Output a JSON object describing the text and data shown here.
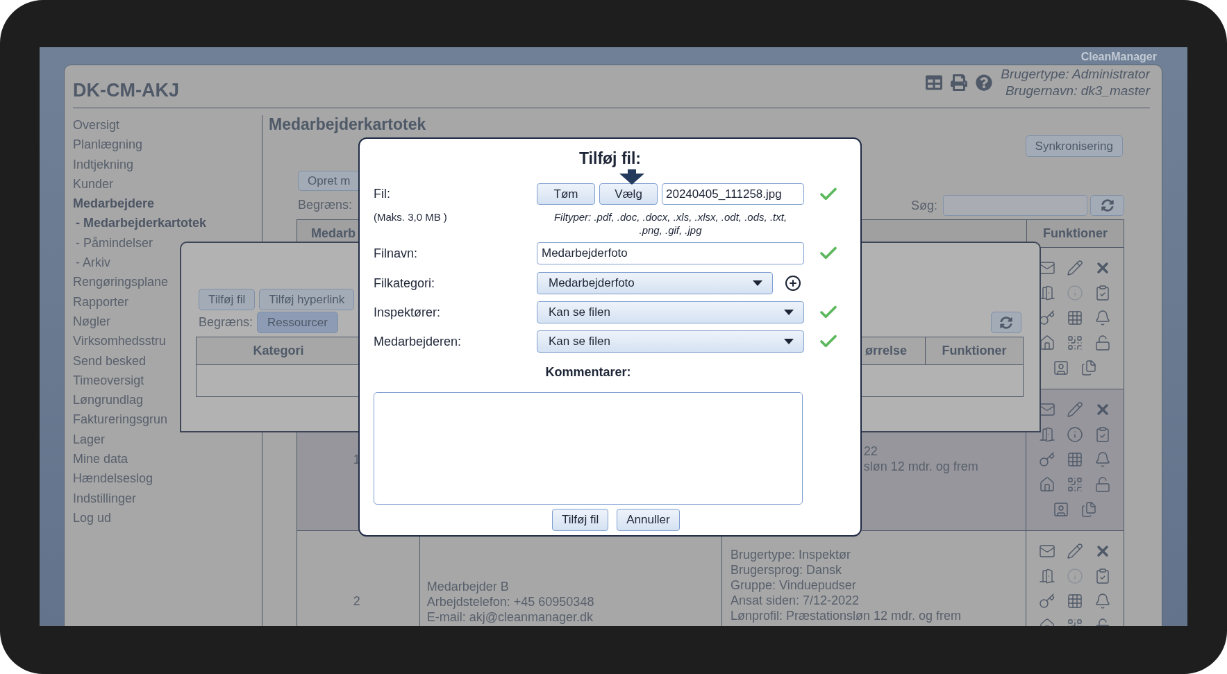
{
  "brand": "CleanManager",
  "app_title": "DK-CM-AKJ",
  "user_info": [
    "Brugertype: Administrator",
    "Brugernavn: dk3_master"
  ],
  "sidebar": {
    "items": [
      {
        "label": "Oversigt",
        "selected": false
      },
      {
        "label": "Planlægning",
        "selected": false
      },
      {
        "label": "Indtjekning",
        "selected": false
      },
      {
        "label": "Kunder",
        "selected": false
      },
      {
        "label": "Medarbejdere",
        "selected": true,
        "children": [
          {
            "label": "- Medarbejderkartotek",
            "selected": true
          },
          {
            "label": "- Påmindelser",
            "selected": false
          },
          {
            "label": "- Arkiv",
            "selected": false
          }
        ]
      },
      {
        "label": "Rengøringsplane",
        "selected": false
      },
      {
        "label": "Rapporter",
        "selected": false
      },
      {
        "label": "Nøgler",
        "selected": false
      },
      {
        "label": "Virksomhedsstru",
        "selected": false
      },
      {
        "label": "Send besked",
        "selected": false
      },
      {
        "label": "Timeoversigt",
        "selected": false
      },
      {
        "label": "Løngrundlag",
        "selected": false
      },
      {
        "label": "Faktureringsgrun",
        "selected": false
      },
      {
        "label": "Lager",
        "selected": false
      },
      {
        "label": "Mine data",
        "selected": false
      },
      {
        "label": "Hændelseslog",
        "selected": false
      },
      {
        "label": "Indstillinger",
        "selected": false
      },
      {
        "label": "Log ud",
        "selected": false
      }
    ]
  },
  "page": {
    "heading": "Medarbejderkartotek",
    "sync_button": "Synkronisering",
    "create_button": "Opret m",
    "filter_label": "Begræns:",
    "search_label": "Søg:",
    "table": {
      "column_1": "Medarb",
      "column_4": "Funktioner",
      "rows": [
        {
          "highlighted": false,
          "info_enabled": false
        },
        {
          "highlighted": true,
          "covered": true,
          "info_enabled": true,
          "number": "1",
          "details": [
            "22",
            "sløn 12 mdr. og frem"
          ]
        },
        {
          "highlighted": false,
          "covered": false,
          "info_enabled": false,
          "number": "2",
          "contact": [
            "Medarbejder B",
            "Arbejdstelefon: +45 60950348",
            "E-mail: akj@cleanmanager.dk"
          ],
          "details": [
            "Brugertype: Inspektør",
            "Brugersprog: Dansk",
            "Gruppe: Vinduepudser",
            "Ansat siden: 7/12-2022",
            "Lønprofil: Præstationsløn 12 mdr. og frem"
          ]
        }
      ]
    }
  },
  "files_dialog": {
    "buttons": [
      "Tilføj fil",
      "Tilføj hyperlink"
    ],
    "filter_label": "Begræns:",
    "tabs": [
      {
        "label": "Ressourcer",
        "selected": true
      }
    ],
    "table": {
      "column_1": "Kategori",
      "column_3": "ørrelse",
      "column_4": "Funktioner"
    }
  },
  "add_file_dialog": {
    "title": "Tilføj fil:",
    "fields": [
      {
        "kind": "file",
        "label": "Fil:",
        "note": "(Maks. 3,0 MB )",
        "buttons": [
          "Tøm",
          "Vælg"
        ],
        "value": "20240405_111258.jpg",
        "hint": "Filtyper: .pdf, .doc, .docx, .xls, .xlsx, .odt, .ods, .txt, .png, .gif, .jpg",
        "valid": true
      },
      {
        "kind": "text",
        "label": "Filnavn:",
        "value": "Medarbejderfoto",
        "valid": true
      },
      {
        "kind": "select",
        "label": "Filkategori:",
        "value": "Medarbejderfoto",
        "valid": false,
        "addable": true
      },
      {
        "kind": "select",
        "label": "Inspektører:",
        "value": "Kan se filen",
        "valid": true
      },
      {
        "kind": "select",
        "label": "Medarbejderen:",
        "value": "Kan se filen",
        "valid": true
      }
    ],
    "comments_label": "Kommentarer:",
    "buttons": [
      "Tilføj fil",
      "Annuller"
    ]
  }
}
